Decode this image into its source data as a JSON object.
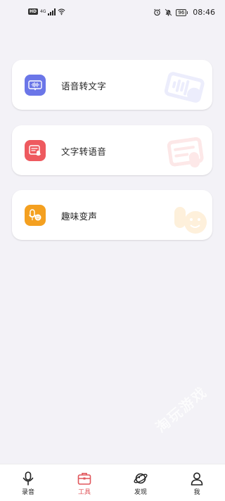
{
  "status_bar": {
    "hd": "HD",
    "network": "4G",
    "battery": "96",
    "time": "08:46"
  },
  "tools": [
    {
      "label": "语音转文字",
      "icon": "voice-to-text-icon",
      "color": "#6b76e8"
    },
    {
      "label": "文字转语音",
      "icon": "text-to-voice-icon",
      "color": "#ee5a5f"
    },
    {
      "label": "趣味变声",
      "icon": "voice-changer-icon",
      "color": "#f4a020"
    }
  ],
  "nav": {
    "items": [
      {
        "label": "录音",
        "icon": "microphone-icon"
      },
      {
        "label": "工具",
        "icon": "toolbox-icon",
        "active": true
      },
      {
        "label": "发现",
        "icon": "planet-icon"
      },
      {
        "label": "我",
        "icon": "user-icon"
      }
    ],
    "active_color": "#e0565b"
  },
  "watermark": "淘玩游戏"
}
